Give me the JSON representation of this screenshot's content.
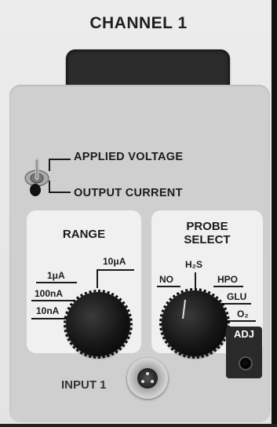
{
  "panel": {
    "title": "CHANNEL 1",
    "toggle": {
      "up_label": "APPLIED VOLTAGE",
      "down_label": "OUTPUT CURRENT"
    },
    "range": {
      "title": "RANGE",
      "options": [
        "1μA",
        "100nA",
        "10nA",
        "10μA"
      ]
    },
    "probe_select": {
      "title_line1": "PROBE",
      "title_line2": "SELECT",
      "options": [
        "NO",
        "H₂S",
        "HPO",
        "GLU",
        "O₂"
      ]
    },
    "adj_label": "ADJ",
    "input_label": "INPUT 1"
  },
  "colors": {
    "panel_face": "#e9e9e9",
    "inner_panel": "#cfcfcf",
    "label_box": "#f0f0f0",
    "display": "#2c2c2c",
    "text": "#1b1b1b"
  }
}
